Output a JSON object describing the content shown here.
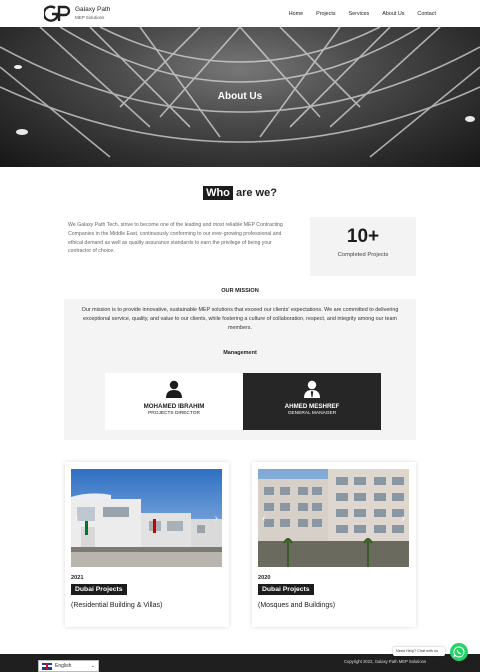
{
  "header": {
    "logo_line1": "Galaxy Path",
    "logo_line2": "MEP Solutions",
    "nav": [
      "Home",
      "Projects",
      "Services",
      "About Us",
      "Contact"
    ]
  },
  "hero": {
    "title": "About Us"
  },
  "about": {
    "heading_highlight": "Who",
    "heading_rest": "are we?",
    "intro": "We Galaxy Path Tech, strive to become one of the leading and most reliable MEP Contracting Companies in the Middle East, continuously conforming to our ever-growing professional and ethical demand as well as quality assurance standards to earn the privilege of being your contractor of choice.",
    "stat_number": "10+",
    "stat_label": "Completed Projects"
  },
  "mission": {
    "title": "OUR MISSION",
    "text": "Our mission is to provide innovative, sustainable MEP solutions that exceed our clients' expectations. We are committed to delivering exceptional service, quality, and value to our clients, while fostering a culture of collaboration, respect, and integrity among our team members.",
    "management_title": "Management",
    "managers": [
      {
        "name": "MOHAMED IBRAHIM",
        "role": "PROJECTS DIRECTOR",
        "icon": "user-icon"
      },
      {
        "name": "AHMED MESHREF",
        "role": "GENERAL MANAGER",
        "icon": "user-tie-icon"
      }
    ]
  },
  "projects": [
    {
      "year": "2021",
      "tag": "Dubai Projects",
      "desc": "(Residential Building & Villas)"
    },
    {
      "year": "2020",
      "tag": "Dubai Projects",
      "desc": "(Mosques and Buildings)"
    }
  ],
  "footer": {
    "copyright": "Copyright 2022, Galaxy Path MEP Solutions",
    "language": "English",
    "help_text": "Need Help? Chat with us"
  },
  "colors": {
    "dark": "#1c1c1c",
    "whatsapp": "#25d366",
    "panel": "#f4f4f4"
  }
}
